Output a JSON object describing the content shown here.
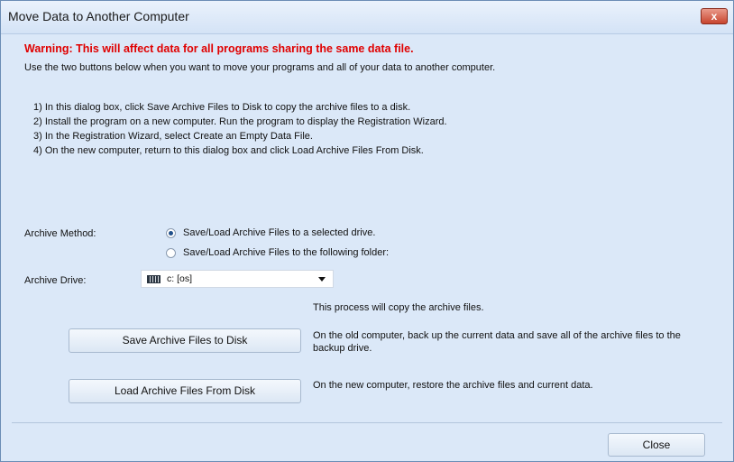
{
  "window": {
    "title": "Move Data to Another Computer",
    "close_glyph": "x"
  },
  "dialog": {
    "warning": "Warning:  This will affect data for all programs sharing the same data file.",
    "intro": "Use the two buttons below when you want to move your programs and all of your data to another computer.",
    "steps": [
      "1) In this dialog box, click Save Archive Files to Disk to copy the archive files to a disk.",
      "2) Install the program on a new computer. Run the program to display the Registration Wizard.",
      "3) In the Registration Wizard, select Create an Empty Data File.",
      "4) On the new computer, return to this dialog box and click Load Archive Files From Disk."
    ],
    "archive_method_label": "Archive Method:",
    "archive_options": [
      {
        "label": "Save/Load Archive Files to a selected drive.",
        "selected": true
      },
      {
        "label": "Save/Load Archive Files to the following folder:",
        "selected": false
      }
    ],
    "archive_drive_label": "Archive Drive:",
    "archive_drive_value": "c: [os]",
    "drive_icon": "hard-drive-icon",
    "process_note": "This process will copy the archive files.",
    "save_button": {
      "label": "Save Archive Files to Disk",
      "description": "On the old computer, back up the current data and save all of the archive files to the backup drive."
    },
    "load_button": {
      "label": "Load Archive Files From Disk",
      "description": "On the new computer, restore the archive files and current data."
    },
    "close_label": "Close"
  },
  "colors": {
    "warning": "#e00000",
    "background": "#dbe8f8",
    "close_button": "#c8452f"
  }
}
